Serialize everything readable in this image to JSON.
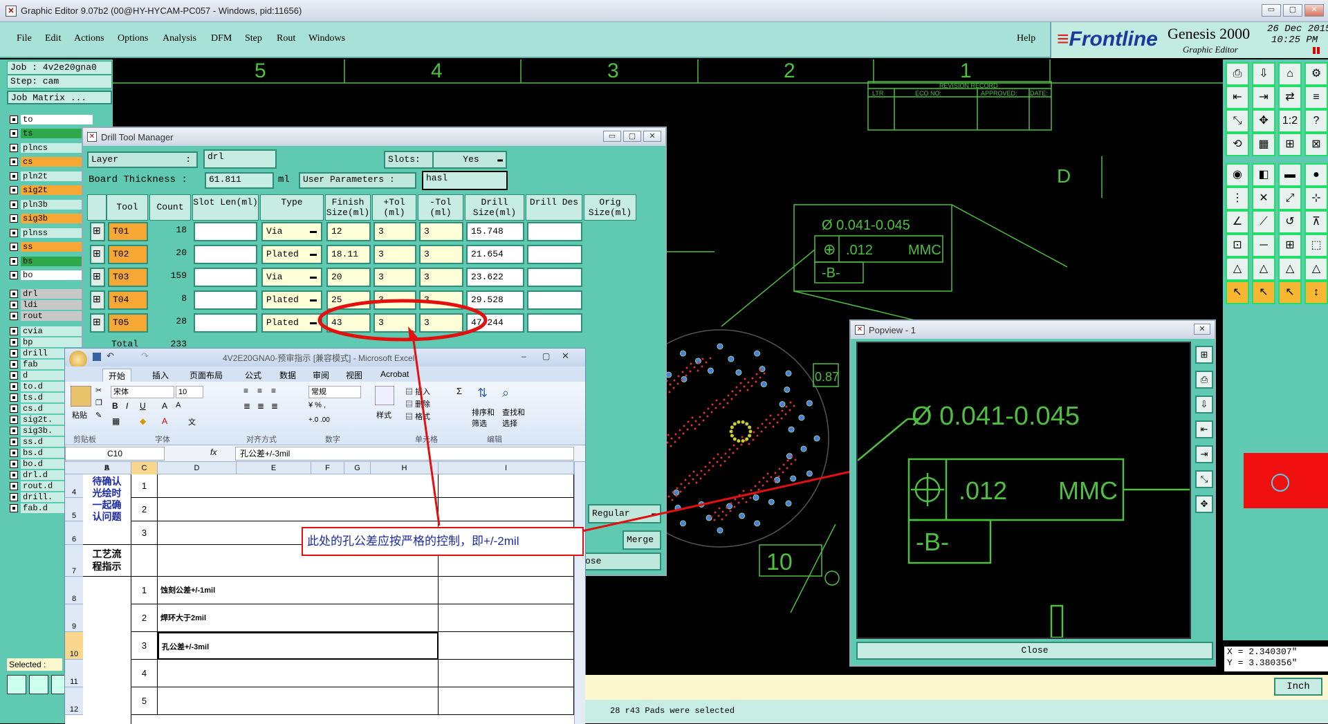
{
  "window": {
    "title": "Graphic Editor 9.07b2 (00@HY-HYCAM-PC057 - Windows, pid:11656)",
    "min": "▭",
    "max": "▢",
    "close": "✕"
  },
  "menu": {
    "file": "File",
    "edit": "Edit",
    "actions": "Actions",
    "options": "Options",
    "analysis": "Analysis",
    "dfm": "DFM",
    "step": "Step",
    "rout": "Rout",
    "windows": "Windows",
    "help": "Help"
  },
  "brand": {
    "logo": "Frontline",
    "product": "Genesis 2000",
    "sub": "Graphic Editor",
    "date": "26 Dec 2015",
    "time": "10:25 PM"
  },
  "left": {
    "job": "Job : 4v2e20gna0",
    "step": "Step: cam",
    "matrix": "Job Matrix ...",
    "selected": "Selected :",
    "layers": [
      {
        "n": "to",
        "bg": "#ffffff"
      },
      {
        "n": "ts",
        "bg": "#2ea84a"
      },
      {
        "n": "plncs",
        "bg": "#c7ede5"
      },
      {
        "n": "cs",
        "bg": "#f7a733"
      },
      {
        "n": "pln2t",
        "bg": "#c7ede5"
      },
      {
        "n": "sig2t",
        "bg": "#f7a733"
      },
      {
        "n": "pln3b",
        "bg": "#c7ede5"
      },
      {
        "n": "sig3b",
        "bg": "#f7a733"
      },
      {
        "n": "plnss",
        "bg": "#c7ede5"
      },
      {
        "n": "ss",
        "bg": "#f7a733"
      },
      {
        "n": "bs",
        "bg": "#2ea84a"
      },
      {
        "n": "bo",
        "bg": "#ffffff"
      },
      {
        "n": "drl",
        "bg": "#c8c8c8"
      },
      {
        "n": "ldi",
        "bg": "#c8c8c8"
      },
      {
        "n": "rout",
        "bg": "#c8c8c8"
      },
      {
        "n": "cvia",
        "bg": "#c7ede5"
      },
      {
        "n": "bp",
        "bg": "#c7ede5"
      },
      {
        "n": "drill",
        "bg": "#c7ede5"
      },
      {
        "n": "fab",
        "bg": "#c7ede5"
      },
      {
        "n": "d",
        "bg": "#c7ede5"
      },
      {
        "n": "to.d",
        "bg": "#c7ede5"
      },
      {
        "n": "ts.d",
        "bg": "#c7ede5"
      },
      {
        "n": "cs.d",
        "bg": "#c7ede5"
      },
      {
        "n": "sig2t.",
        "bg": "#c7ede5"
      },
      {
        "n": "sig3b.",
        "bg": "#c7ede5"
      },
      {
        "n": "ss.d",
        "bg": "#c7ede5"
      },
      {
        "n": "bs.d",
        "bg": "#c7ede5"
      },
      {
        "n": "bo.d",
        "bg": "#c7ede5"
      },
      {
        "n": "drl.d",
        "bg": "#c7ede5"
      },
      {
        "n": "rout.d",
        "bg": "#c7ede5"
      },
      {
        "n": "drill.",
        "bg": "#c7ede5"
      },
      {
        "n": "fab.d",
        "bg": "#c7ede5"
      }
    ]
  },
  "canvas": {
    "cols": [
      "5",
      "4",
      "3",
      "2",
      "1"
    ],
    "rev_title": "REVISION RECORD",
    "rev_ltr": "LTR",
    "rev_eco": "ECO NO:",
    "rev_app": "APPROVED:",
    "rev_date": "DATE:",
    "row_d": "D",
    "tol": "Ø 0.041-0.045",
    "tol2": ".012",
    "mmc": "MMC",
    "datum": "-B-",
    "dim": "0.87",
    "dim2": "10"
  },
  "dtm": {
    "title": "Drill Tool Manager",
    "layer_label": "Layer",
    "layer": "drl",
    "slots_label": "Slots:",
    "slots": "Yes",
    "thk_label": "Board Thickness :",
    "thk": "61.811",
    "unit": "ml",
    "up_label": "User Parameters :",
    "up": "hasl",
    "headers": [
      "Tool",
      "Count",
      "Slot Len(ml)",
      "Type",
      "Finish Size(ml)",
      "+Tol (ml)",
      "-Tol (ml)",
      "Drill Size(ml)",
      "Drill Des",
      "Orig Size(ml)"
    ],
    "rows": [
      {
        "tool": "T01",
        "count": "18",
        "type": "Via",
        "finish": "12",
        "ptol": "3",
        "ntol": "3",
        "drill": "15.748"
      },
      {
        "tool": "T02",
        "count": "20",
        "type": "Plated",
        "finish": "18.11",
        "ptol": "3",
        "ntol": "3",
        "drill": "21.654"
      },
      {
        "tool": "T03",
        "count": "159",
        "type": "Via",
        "finish": "20",
        "ptol": "3",
        "ntol": "3",
        "drill": "23.622"
      },
      {
        "tool": "T04",
        "count": "8",
        "type": "Plated",
        "finish": "25",
        "ptol": "3",
        "ntol": "3",
        "drill": "29.528"
      },
      {
        "tool": "T05",
        "count": "28",
        "type": "Plated",
        "finish": "43",
        "ptol": "3",
        "ntol": "3",
        "drill": "47.244"
      }
    ],
    "total_label": "Total",
    "total": "233",
    "regular": "Regular",
    "merge": "Merge",
    "close": "ose"
  },
  "annotation": "此处的孔公差应按严格的控制，即+/-2mil",
  "excel": {
    "title": "4V2E20GNA0-预审指示 [兼容模式] - Microsoft Excel",
    "tabs": [
      "开始",
      "插入",
      "页面布局",
      "公式",
      "数据",
      "审阅",
      "视图",
      "Acrobat"
    ],
    "font": "宋体",
    "size": "10",
    "numfmt": "常规",
    "paste": "粘贴",
    "g_clip": "剪贴板",
    "g_font": "字体",
    "g_align": "对齐方式",
    "g_num": "数字",
    "g_style": "样式",
    "g_cell": "单元格",
    "g_edit": "编辑",
    "insert": "插入",
    "delete": "删除",
    "format": "格式",
    "sort": "排序和筛选",
    "find": "查找和选择",
    "style": "样式",
    "namebox": "C10",
    "fx": "fx",
    "formula": "孔公差+/-3mil",
    "cols": [
      "A",
      "B",
      "C",
      "D",
      "E",
      "F",
      "G",
      "H",
      "I"
    ],
    "rowsn": [
      "4",
      "5",
      "6",
      "7",
      "8",
      "9",
      "10",
      "11",
      "12"
    ],
    "a456": "待确认光绘时一起确认问题",
    "a7": "工艺流程指示",
    "b": [
      "1",
      "2",
      "3",
      "",
      "1",
      "2",
      "3",
      "4",
      "5"
    ],
    "c8": "蚀刻公差+/-1mil",
    "c9": "焊环大于2mil",
    "c10": "孔公差+/-3mil"
  },
  "popview": {
    "title": "Popview - 1",
    "tol": "Ø 0.041-0.045",
    "tol2": ".012",
    "mmc": "MMC",
    "datum": "-B-",
    "close": "Close"
  },
  "coords": {
    "x": "X = 2.340307\"",
    "y": "Y = 3.380356\""
  },
  "status": {
    "unit": "Inch",
    "msg": "28 r43 Pads were selected"
  }
}
